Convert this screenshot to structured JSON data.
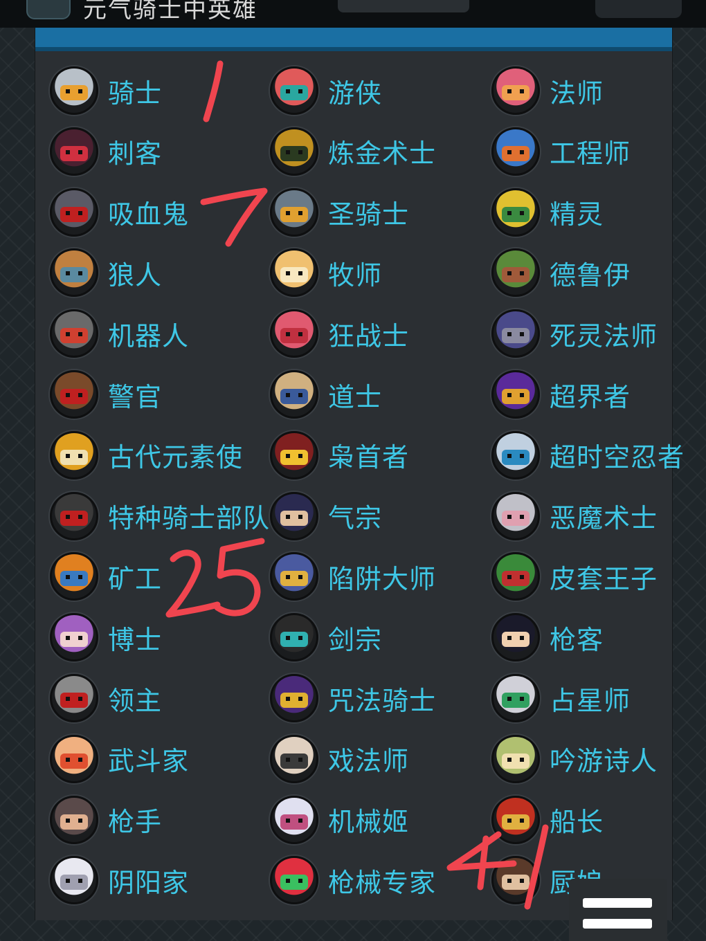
{
  "header": {
    "title": "元气骑士中英雄"
  },
  "characters": [
    {
      "name": "骑士",
      "color": "#b8c0c8",
      "accent": "#e8a030"
    },
    {
      "name": "游侠",
      "color": "#e05a5a",
      "accent": "#2aa7a0"
    },
    {
      "name": "法师",
      "color": "#e0607a",
      "accent": "#f0a050"
    },
    {
      "name": "刺客",
      "color": "#4a2030",
      "accent": "#d03040"
    },
    {
      "name": "炼金术士",
      "color": "#c09020",
      "accent": "#2a3a20"
    },
    {
      "name": "工程师",
      "color": "#3a78c8",
      "accent": "#e07030"
    },
    {
      "name": "吸血鬼",
      "color": "#5a5a66",
      "accent": "#c02020"
    },
    {
      "name": "圣骑士",
      "color": "#6a7a88",
      "accent": "#e0a030"
    },
    {
      "name": "精灵",
      "color": "#e0c030",
      "accent": "#3a8a40"
    },
    {
      "name": "狼人",
      "color": "#c08040",
      "accent": "#5a8aa0"
    },
    {
      "name": "牧师",
      "color": "#f0c070",
      "accent": "#f8e8c0"
    },
    {
      "name": "德鲁伊",
      "color": "#5a8a3a",
      "accent": "#a05a3a"
    },
    {
      "name": "机器人",
      "color": "#6a6a6a",
      "accent": "#d04030"
    },
    {
      "name": "狂战士",
      "color": "#e05a70",
      "accent": "#c03040"
    },
    {
      "name": "死灵法师",
      "color": "#4a4a8a",
      "accent": "#8a8aa0"
    },
    {
      "name": "警官",
      "color": "#7a4a2a",
      "accent": "#c02020"
    },
    {
      "name": "道士",
      "color": "#d0b080",
      "accent": "#3a5a9a"
    },
    {
      "name": "超界者",
      "color": "#5a2a9a",
      "accent": "#e0a030"
    },
    {
      "name": "古代元素使",
      "color": "#e0a020",
      "accent": "#f0e0b0"
    },
    {
      "name": "枭首者",
      "color": "#802020",
      "accent": "#f0c030"
    },
    {
      "name": "超时空忍者",
      "color": "#c0d0e0",
      "accent": "#2a8ac0"
    },
    {
      "name": "特种骑士部队",
      "color": "#3a3a3a",
      "accent": "#c02020"
    },
    {
      "name": "气宗",
      "color": "#2a2a50",
      "accent": "#e0c0a0"
    },
    {
      "name": "恶魔术士",
      "color": "#c0c0c8",
      "accent": "#e0a0b0"
    },
    {
      "name": "矿工",
      "color": "#e08020",
      "accent": "#3a7ac0"
    },
    {
      "name": "陷阱大师",
      "color": "#4a5aa0",
      "accent": "#e0b040"
    },
    {
      "name": "皮套王子",
      "color": "#3a8a3a",
      "accent": "#c03030"
    },
    {
      "name": "博士",
      "color": "#a060c0",
      "accent": "#f0d0d0"
    },
    {
      "name": "剑宗",
      "color": "#2a2a2a",
      "accent": "#30b0b0"
    },
    {
      "name": "枪客",
      "color": "#1a1a2a",
      "accent": "#f0d0b0"
    },
    {
      "name": "领主",
      "color": "#8a8a8a",
      "accent": "#c02020"
    },
    {
      "name": "咒法骑士",
      "color": "#4a2a7a",
      "accent": "#e0b030"
    },
    {
      "name": "占星师",
      "color": "#d0d0d8",
      "accent": "#30a060"
    },
    {
      "name": "武斗家",
      "color": "#f0b080",
      "accent": "#e05030"
    },
    {
      "name": "戏法师",
      "color": "#e0d0c0",
      "accent": "#3a3a3a"
    },
    {
      "name": "吟游诗人",
      "color": "#b0c070",
      "accent": "#f0e0b0"
    },
    {
      "name": "枪手",
      "color": "#5a4a4a",
      "accent": "#e0b090"
    },
    {
      "name": "机械姬",
      "color": "#e0e0f0",
      "accent": "#c05080"
    },
    {
      "name": "船长",
      "color": "#c03020",
      "accent": "#e0b040"
    },
    {
      "name": "阴阳家",
      "color": "#e8e8f0",
      "accent": "#a0a0b0"
    },
    {
      "name": "枪械专家",
      "color": "#e03040",
      "accent": "#3ac060"
    },
    {
      "name": "厨娘",
      "color": "#5a3a2a",
      "accent": "#e0c0a0"
    }
  ],
  "annotations": [
    "1",
    "7",
    "25",
    "41"
  ],
  "colors": {
    "name_text": "#3ec7e6",
    "panel_bg": "#2b2f33",
    "header_strip": "#1a6fa3",
    "annotation_red": "#f0454f"
  },
  "menu": {
    "icon": "menu-icon"
  }
}
